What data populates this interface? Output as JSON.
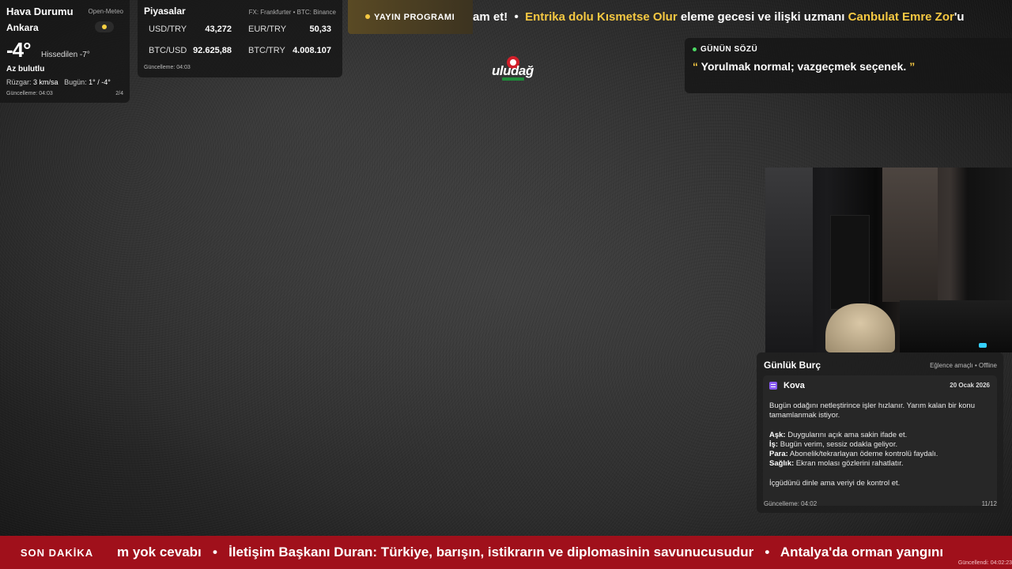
{
  "weather": {
    "title": "Hava Durumu",
    "source": "Open-Meteo",
    "city": "Ankara",
    "temp": "-4°",
    "feels_like": "Hissedilen -7°",
    "condition": "Az bulutlu",
    "wind_label": "Rüzgar:",
    "wind_value": "3 km/sa",
    "today_label": "Bugün:",
    "today_value": "1° / -4°",
    "updated": "Güncelleme: 04:03",
    "page": "2/4",
    "condition_icon": "partly-cloudy-icon"
  },
  "markets": {
    "title": "Piyasalar",
    "source": "FX: Frankfurter • BTC: Binance",
    "rows": [
      {
        "label": "USD/TRY",
        "value": "43,272"
      },
      {
        "label": "EUR/TRY",
        "value": "50,33"
      },
      {
        "label": "BTC/USD",
        "value": "92.625,88"
      },
      {
        "label": "BTC/TRY",
        "value": "4.008.107"
      }
    ],
    "updated": "Güncelleme: 04:03"
  },
  "schedule": {
    "label": "YAYIN PROGRAMI"
  },
  "top_ticker": {
    "part1": "am et!",
    "sep": "•",
    "part2": "Entrika dolu Kısmetse Olur",
    "part3": "eleme gecesi ve ilişki uzmanı",
    "part4": "Canbulat Emre Zor",
    "part5": "'u"
  },
  "logo": {
    "word": "uludağ",
    "sub": "TERMAL"
  },
  "quote": {
    "header": "GÜNÜN SÖZÜ",
    "open_mark": "“",
    "text": "Yorulmak normal; vazgeçmek seçenek.",
    "close_mark": "”"
  },
  "horoscope": {
    "title": "Günlük Burç",
    "mode": "Eğlence amaçlı • Offline",
    "sign": "Kova",
    "date": "20 Ocak 2026",
    "intro": "Bugün odağını netleştirince işler hızlanır. Yarım kalan bir konu tamamlanmak istiyor.",
    "love_label": "Aşk:",
    "love": "Duygularını açık ama sakin ifade et.",
    "work_label": "İş:",
    "work": "Bugün verim, sessiz odakla geliyor.",
    "money_label": "Para:",
    "money": "Abonelik/tekrarlayan ödeme kontrolü faydalı.",
    "health_label": "Sağlık:",
    "health": "Ekran molası gözlerini rahatlatır.",
    "advice": "İçgüdünü dinle ama veriyi de kontrol et.",
    "updated": "Güncelleme: 04:02",
    "page": "11/12"
  },
  "breaking": {
    "label": "SON DAKİKA",
    "item1": "m yok cevabı",
    "sep": "•",
    "item2": "İletişim Başkanı Duran: Türkiye, barışın, istikrarın ve diplomasinin savunucusudur",
    "item3": "Antalya'da orman yangını",
    "stamp": "Güncellendi: 04:02:23"
  },
  "colors": {
    "accent_yellow": "#f5c842",
    "breaking_red": "#a0101b",
    "live_green": "#4cd964"
  }
}
